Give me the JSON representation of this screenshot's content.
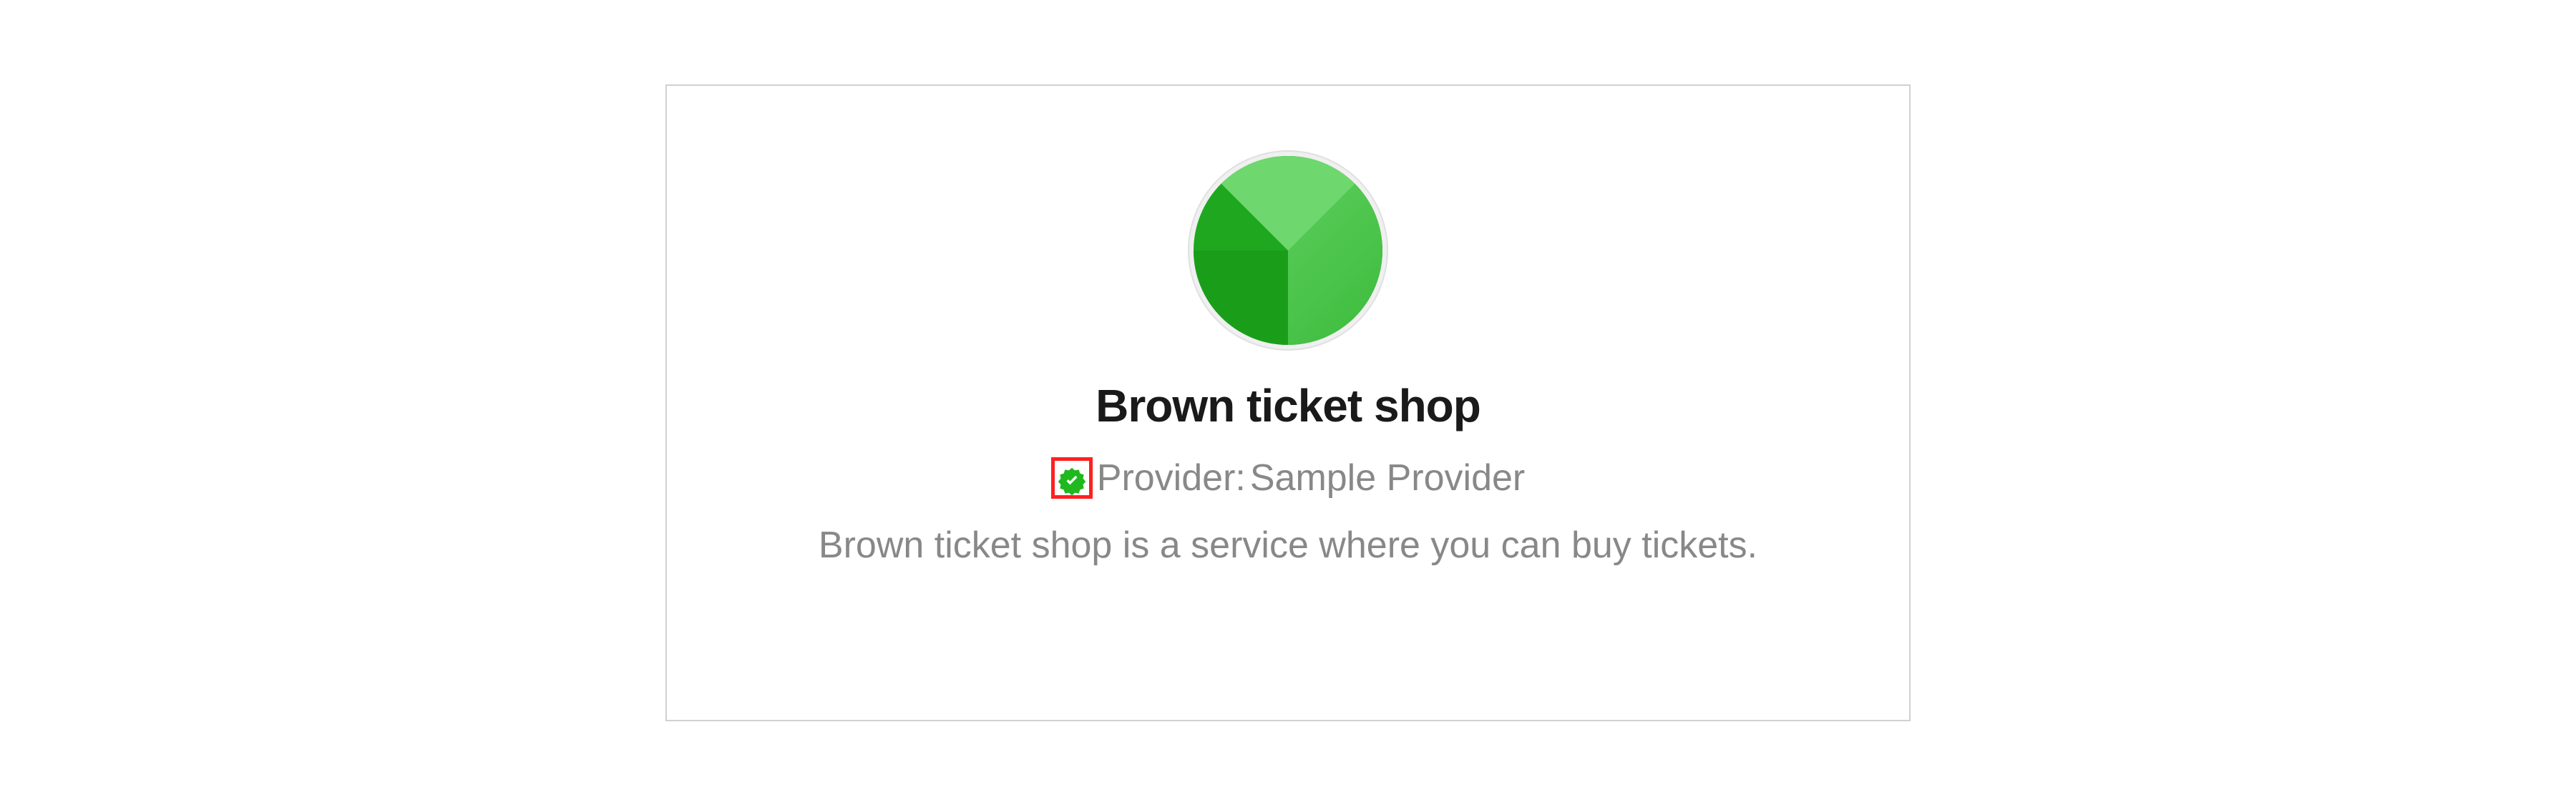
{
  "shop": {
    "title": "Brown ticket shop",
    "provider_label": "Provider:",
    "provider_name": "Sample Provider",
    "description": "Brown ticket shop is a service where you can buy tickets."
  },
  "icons": {
    "logo": "circle-logo",
    "verified": "verified-badge-icon"
  },
  "colors": {
    "logo_green_primary": "#1fa81f",
    "logo_green_light": "#6ed86e",
    "highlight_red": "#ff2020",
    "text_primary": "#1a1a1a",
    "text_secondary": "#888888"
  }
}
